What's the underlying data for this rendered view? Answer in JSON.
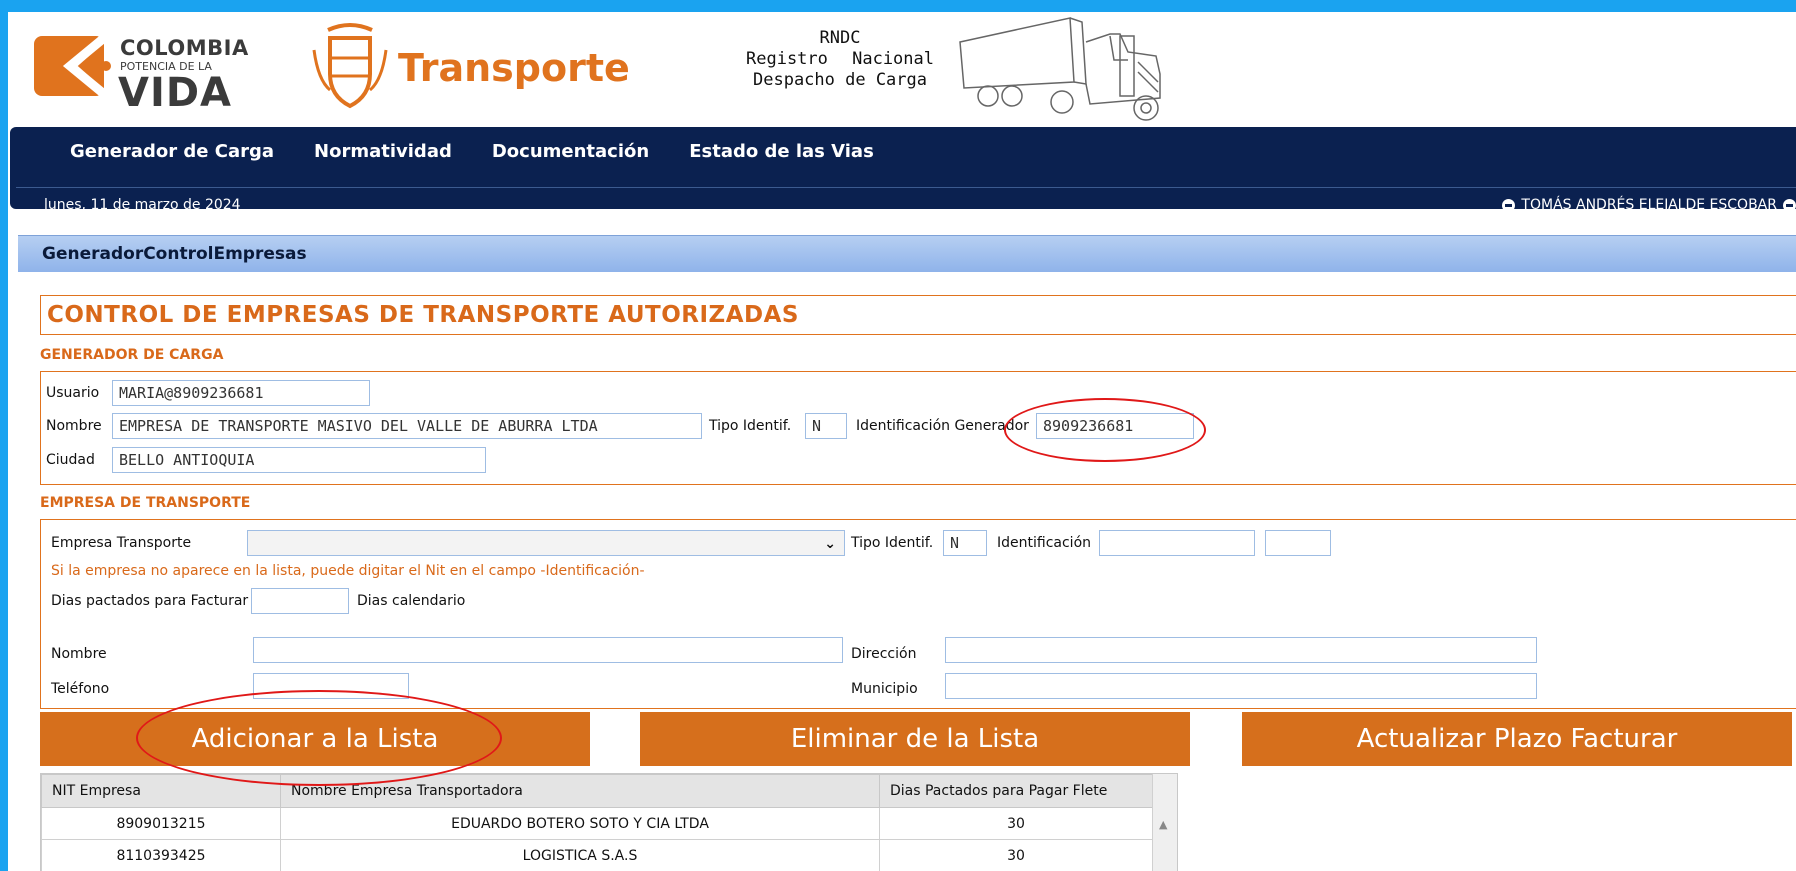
{
  "logos": {
    "colombia": {
      "line1": "COLOMBIA",
      "line2": "POTENCIA DE LA",
      "line3": "VIDA"
    },
    "ministry": "Transporte",
    "rndc": {
      "title": "RNDC",
      "line2a": "Registro",
      "line2b": "Nacional",
      "line3": "Despacho de Carga"
    }
  },
  "nav": {
    "items": [
      "Generador de Carga",
      "Normatividad",
      "Documentación",
      "Estado de las Vias"
    ],
    "date": "lunes, 11 de marzo de 2024",
    "user": "TOMÁS ANDRÉS ELEJALDE ESCOBAR"
  },
  "panel": {
    "header": "GeneradorControlEmpresas",
    "title": "CONTROL DE EMPRESAS DE TRANSPORTE AUTORIZADAS"
  },
  "generador": {
    "section_title": "GENERADOR DE CARGA",
    "usuario_label": "Usuario",
    "usuario_value": "MARIA@8909236681",
    "nombre_label": "Nombre",
    "nombre_value": "EMPRESA DE TRANSPORTE MASIVO DEL VALLE DE ABURRA LTDA",
    "tipo_label": "Tipo Identif.",
    "tipo_value": "N",
    "ident_label": "Identificación Generador",
    "ident_value": "8909236681",
    "ciudad_label": "Ciudad",
    "ciudad_value": "BELLO ANTIOQUIA"
  },
  "empresa": {
    "section_title": "EMPRESA DE TRANSPORTE",
    "empresa_label": "Empresa Transporte",
    "empresa_value": "",
    "tipo_label": "Tipo Identif.",
    "tipo_value": "N",
    "ident_label": "Identificación",
    "ident_value": "",
    "ident_dv_value": "",
    "hint": "Si la empresa no aparece en la lista, puede digitar el Nit en el campo -Identificación-",
    "dias_label": "Dias pactados para Facturar",
    "dias_value": "",
    "dias_suffix": "Dias calendario",
    "nombre_label": "Nombre",
    "nombre_value": "",
    "direccion_label": "Dirección",
    "direccion_value": "",
    "telefono_label": "Teléfono",
    "telefono_value": "",
    "municipio_label": "Municipio",
    "municipio_value": ""
  },
  "buttons": {
    "add": "Adicionar a la Lista",
    "remove": "Eliminar de la Lista",
    "update": "Actualizar Plazo Facturar"
  },
  "table": {
    "headers": [
      "NIT Empresa",
      "Nombre Empresa Transportadora",
      "Dias Pactados para Pagar Flete"
    ],
    "rows": [
      [
        "8909013215",
        "EDUARDO BOTERO SOTO Y CIA LTDA",
        "30"
      ],
      [
        "8110393425",
        "LOGISTICA S.A.S",
        "30"
      ]
    ]
  },
  "colors": {
    "accent": "#d66f1c",
    "nav_bg": "#0b2150",
    "frame": "#1aa3f0",
    "annotation": "#e01818"
  }
}
